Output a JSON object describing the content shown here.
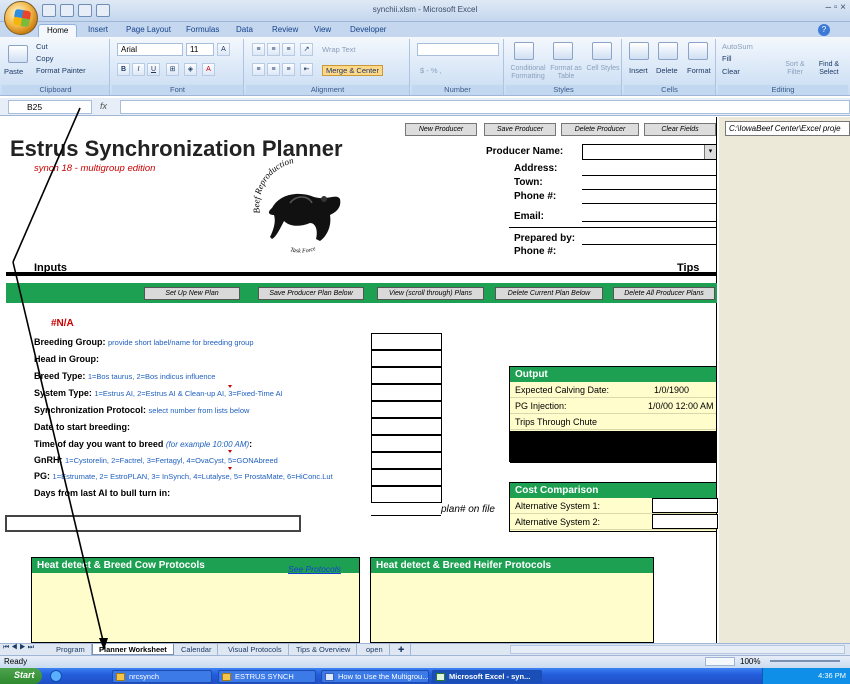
{
  "window": {
    "title": "synchii.xlsm - Microsoft Excel",
    "controls": "– ▫ ×"
  },
  "ribbon_tabs": [
    "Home",
    "Insert",
    "Page Layout",
    "Formulas",
    "Data",
    "Review",
    "View",
    "Developer"
  ],
  "ribbon": {
    "clipboard": {
      "label": "Clipboard",
      "paste": "Paste",
      "cut": "Cut",
      "copy": "Copy",
      "format_painter": "Format Painter"
    },
    "font": {
      "label": "Font",
      "family": "Arial",
      "size": "11"
    },
    "alignment": {
      "label": "Alignment",
      "wrap_text": "Wrap Text",
      "merge": "Merge & Center"
    },
    "number": {
      "label": "Number",
      "format": "",
      "currency": "$ - % ,"
    },
    "styles": {
      "label": "Styles",
      "conditional": "Conditional Formatting",
      "format_table": "Format as Table",
      "cell_styles": "Cell Styles"
    },
    "cells": {
      "label": "Cells",
      "insert": "Insert",
      "delete": "Delete",
      "format": "Format"
    },
    "editing": {
      "label": "Editing",
      "autosum": "AutoSum",
      "fill": "Fill",
      "clear": "Clear",
      "sort": "Sort & Filter",
      "find": "Find & Select"
    }
  },
  "formula_bar": {
    "cell_ref": "B25",
    "fx": "fx",
    "content": ""
  },
  "sheet": {
    "top_buttons": [
      "New Producer",
      "Save Producer",
      "Delete Producer",
      "Clear Fields"
    ],
    "path": "C:\\IowaBeef Center\\Excel proje",
    "title": "Estrus Synchronization Planner",
    "subtitle": "synch 18 - multigroup edition",
    "producer": {
      "name_label": "Producer Name:",
      "address": "Address:",
      "town": "Town:",
      "phone": "Phone #:",
      "email": "Email:",
      "prepared_by": "Prepared by:",
      "phone2": "Phone #:"
    },
    "logo_text": {
      "top": "Beef Reproduction",
      "bottom": "Task Force"
    },
    "inputs_label": "Inputs",
    "tips_label": "Tips",
    "plan_buttons": [
      "Set Up New Plan",
      "Save Producer Plan Below",
      "View (scroll through) Plans",
      "Delete Current Plan Below",
      "Delete All Producer Plans"
    ],
    "na_value": "#N/A",
    "fields": [
      {
        "label": "Breeding Group:",
        "hint": "provide short label/name for breeding group"
      },
      {
        "label": "Head in Group:",
        "hint": ""
      },
      {
        "label": "Breed Type:",
        "hint": "1=Bos taurus,  2=Bos indicus influence"
      },
      {
        "label": "System Type:",
        "hint": "1=Estrus AI,  2=Estrus AI & Clean-up AI,  3=Fixed-Time AI"
      },
      {
        "label": "Synchronization Protocol:",
        "hint": "select number from lists below"
      },
      {
        "label": "Date to start breeding:",
        "hint": ""
      },
      {
        "label": "Time of day you want to breed",
        "hint": "(for example 10:00 AM)",
        "suffix": ":"
      },
      {
        "label": "GnRH:",
        "hint": "1=Cystorelin, 2=Factrel, 3=Fertagyl, 4=OvaCyst, 5=GONAbreed"
      },
      {
        "label": "PG:",
        "hint": "1=Estrumate, 2= EstroPLAN, 3= InSynch, 4=Lutalyse, 5= ProstaMate, 6=HiConc.Lut"
      },
      {
        "label": "Days from last AI to bull turn in:",
        "hint": ""
      }
    ],
    "plan_on_file": "plan# on file",
    "output": {
      "title": "Output",
      "rows": [
        {
          "label": "Expected Calving Date:",
          "value": "1/0/1900"
        },
        {
          "label": "PG Injection:",
          "value": "1/0/00 12:00 AM"
        },
        {
          "label": "Trips Through Chute",
          "value": ""
        }
      ]
    },
    "cost": {
      "title": "Cost Comparison",
      "rows": [
        "Alternative System 1:",
        "Alternative System 2:"
      ]
    },
    "cow_protocols": {
      "title": "Heat detect & Breed Cow Protocols",
      "link": "See Protocols"
    },
    "heifer_protocols": {
      "title": "Heat detect & Breed Heifer Protocols"
    }
  },
  "sheet_tabs": [
    "Program",
    "Planner Worksheet",
    "Calendar",
    "Visual Protocols",
    "Tips & Overview",
    "open"
  ],
  "active_sheet": "Planner Worksheet",
  "status": {
    "text": "Ready",
    "zoom": "100%"
  },
  "taskbar": {
    "start": "Start",
    "items": [
      "nrcsynch",
      "ESTRUS SYNCH",
      "How to Use the Multigrou...",
      "Microsoft Excel - syn..."
    ],
    "time": "4:36 PM"
  },
  "colors": {
    "green": "#1ea052",
    "yellow": "#fffdcc",
    "red": "#cc0000",
    "blue_hint": "#1e5fbf"
  }
}
